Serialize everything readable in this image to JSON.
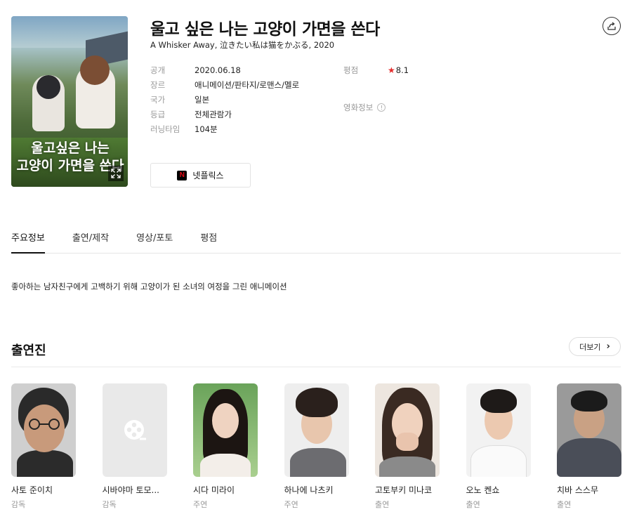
{
  "movie": {
    "title": "울고 싶은 나는 고양이 가면을 쓴다",
    "subtitle": "A Whisker Away, 泣きたい私は猫をかぶる, 2020",
    "poster_text_line1": "울고싶은 나는",
    "poster_text_line2": "고양이 가면을 쓴다"
  },
  "meta": [
    {
      "key": "공개",
      "value": "2020.06.18"
    },
    {
      "key": "장르",
      "value": "애니메이션/판타지/로맨스/멜로"
    },
    {
      "key": "국가",
      "value": "일본"
    },
    {
      "key": "등급",
      "value": "전체관람가"
    },
    {
      "key": "러닝타임",
      "value": "104분"
    }
  ],
  "rating": {
    "key": "평점",
    "value": "8.1",
    "star_color": "#e52c2c"
  },
  "movie_info_label": "영화정보",
  "streaming": {
    "label": "넷플릭스",
    "logo_letter": "N",
    "brand_color": "#e50914"
  },
  "tabs": [
    {
      "label": "주요정보",
      "active": true
    },
    {
      "label": "출연/제작",
      "active": false
    },
    {
      "label": "영상/포토",
      "active": false
    },
    {
      "label": "평점",
      "active": false
    }
  ],
  "synopsis": "좋아하는 남자친구에게 고백하기 위해 고양이가 된 소녀의 여정을 그린 애니메이션",
  "cast_section": {
    "heading": "출연진",
    "more_label": "더보기",
    "members": [
      {
        "name": "사토 준이치",
        "role": "감독"
      },
      {
        "name": "시바야마 토모...",
        "role": "감독"
      },
      {
        "name": "시다 미라이",
        "role": "주연"
      },
      {
        "name": "하나에 나츠키",
        "role": "주연"
      },
      {
        "name": "고토부키 미나코",
        "role": "출연"
      },
      {
        "name": "오노 켄쇼",
        "role": "출연"
      },
      {
        "name": "치바 스스무",
        "role": "출연"
      }
    ]
  },
  "icons": {
    "share": "share-icon",
    "expand": "expand-icon",
    "info": "info-icon",
    "chevron": "chevron-right-icon",
    "film_placeholder": "film-reel-icon"
  }
}
